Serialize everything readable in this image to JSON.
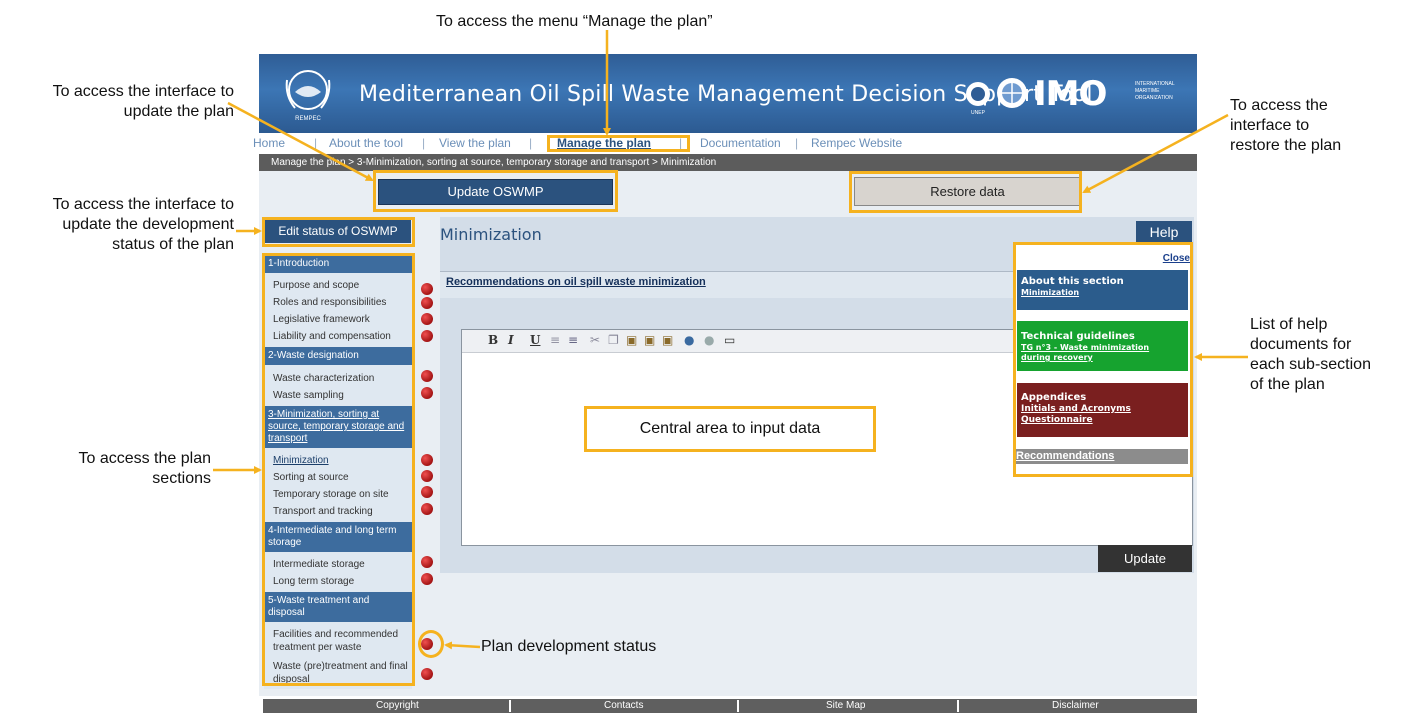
{
  "annotations": {
    "top": "To access the menu “Manage the plan”",
    "update_plan": [
      "To access the interface to",
      "update the plan"
    ],
    "update_status": [
      "To access the interface to",
      "update the development",
      "status of the plan"
    ],
    "plan_sections": [
      "To access the plan",
      "sections"
    ],
    "restore_plan": [
      "To access the",
      "interface to",
      "restore the plan"
    ],
    "help_docs": [
      "List of help",
      "documents for",
      "each sub-section",
      "of the plan"
    ],
    "central_area": "Central area to input data",
    "dev_status": "Plan development status"
  },
  "app": {
    "title": "Mediterranean Oil Spill Waste Management Decision Support Tool",
    "logo_imo": "IMO",
    "logo_imo_sub": [
      "INTERNATIONAL",
      "MARITIME",
      "ORGANIZATION"
    ],
    "logo_unep": "UNEP",
    "logo_rempec": "REMPEC"
  },
  "nav": {
    "items": [
      "Home",
      "About the tool",
      "View the plan",
      "Manage the plan",
      "Documentation",
      "Rempec Website"
    ]
  },
  "breadcrumb": "Manage the plan >  3-Minimization, sorting at source, temporary storage and transport >  Minimization",
  "buttons": {
    "update_oswmp": "Update OSWMP",
    "restore_data": "Restore data",
    "edit_status": "Edit status of OSWMP",
    "help": "Help",
    "update": "Update"
  },
  "sidebar": {
    "sections": [
      {
        "title": "1-Introduction",
        "items": [
          "Purpose and scope",
          "Roles and responsibilities",
          "Legislative framework",
          "Liability and compensation"
        ]
      },
      {
        "title": "2-Waste designation",
        "items": [
          "Waste characterization",
          "Waste sampling"
        ]
      },
      {
        "title": "3-Minimization, sorting at source, temporary storage and transport",
        "items": [
          "Minimization",
          "Sorting at source",
          "Temporary storage on site",
          "Transport and tracking"
        ]
      },
      {
        "title": "4-Intermediate and long term storage",
        "items": [
          "Intermediate storage",
          "Long term storage"
        ]
      },
      {
        "title": "5-Waste treatment and disposal",
        "items": [
          "Facilities and recommended treatment per waste",
          "Waste (pre)treatment and final disposal"
        ]
      }
    ]
  },
  "main": {
    "title": "Minimization",
    "recommendation_link": "Recommendations on oil spill waste minimization",
    "toolbar": [
      "B",
      "I",
      "U"
    ]
  },
  "help_panel": {
    "close": "Close",
    "cards": [
      {
        "title": "About this section",
        "links": [
          "Minimization"
        ],
        "color": "#2b5c8c"
      },
      {
        "title": "Technical guidelines",
        "links": [
          "TG n°3 - Waste minimization",
          "during recovery"
        ],
        "color": "#16a32f"
      },
      {
        "title": "Appendices",
        "links": [
          "Initials and Acronyms",
          "Questionnaire"
        ],
        "color": "#7a1f1f"
      }
    ],
    "recommendations": "Recommendations"
  },
  "footer": [
    "Copyright",
    "Contacts",
    "Site Map",
    "Disclaimer"
  ],
  "colors": {
    "annotation_box": "#f5b21f",
    "status_dot": "#b3191a",
    "banner": "#2f5d95"
  }
}
